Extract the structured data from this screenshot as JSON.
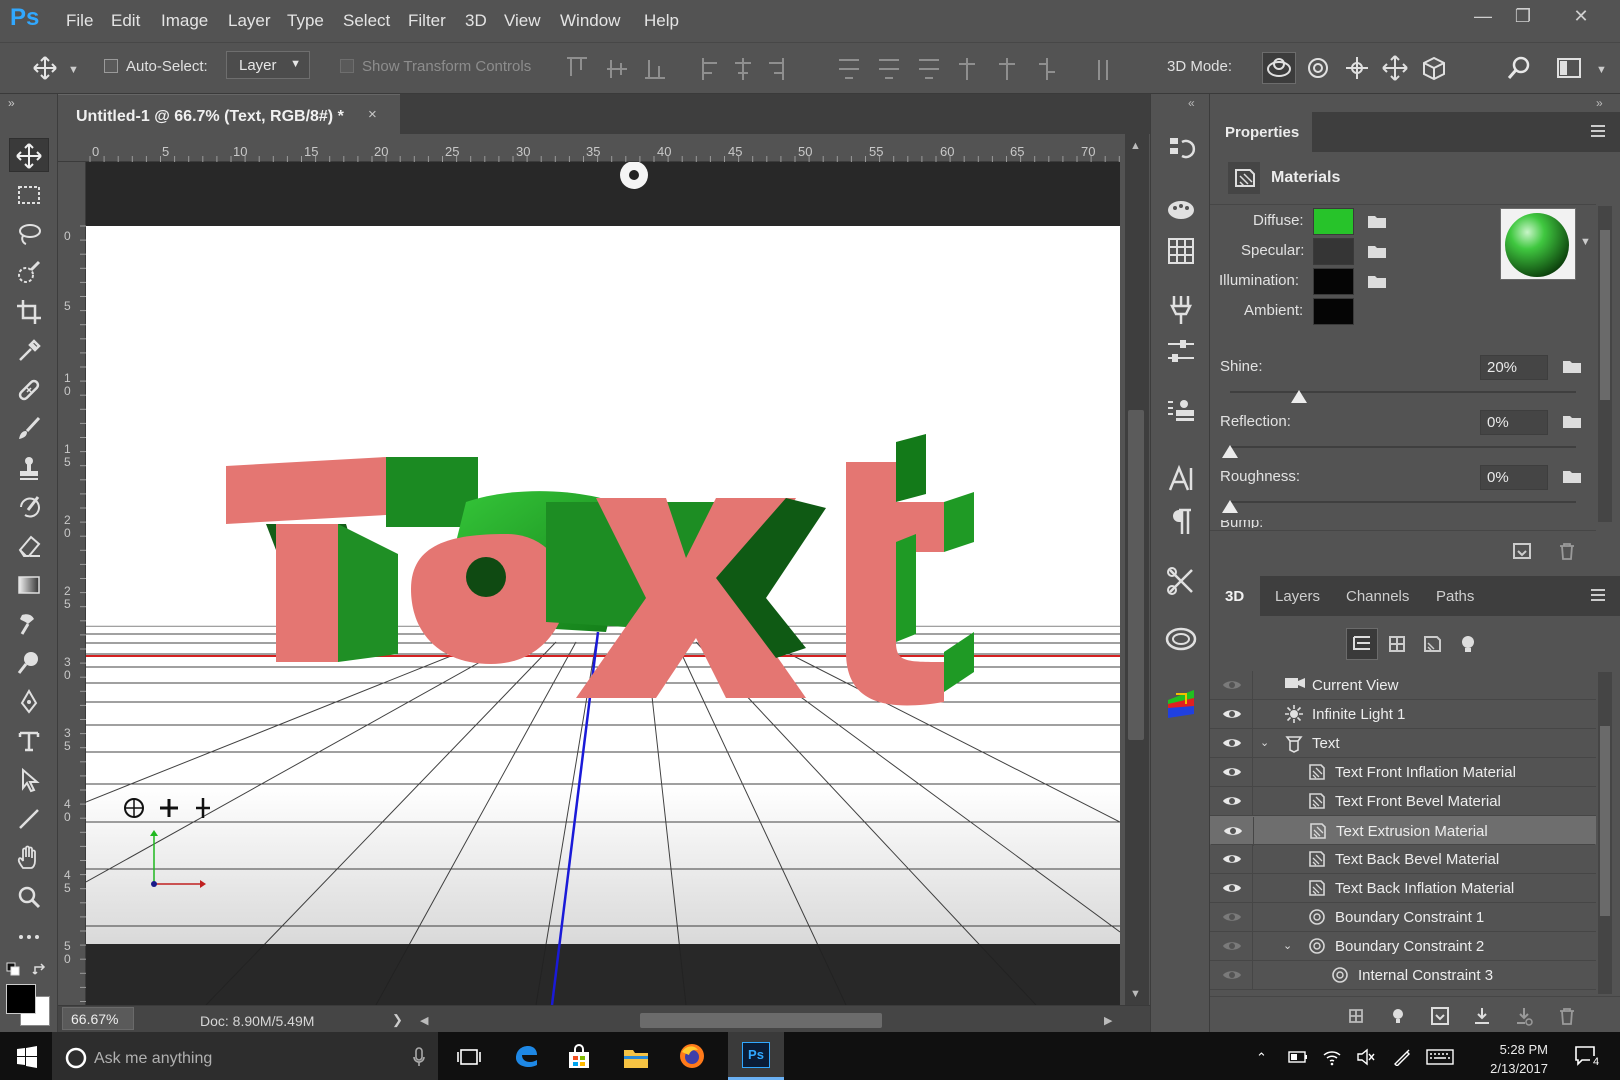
{
  "app": {
    "logo": "Ps"
  },
  "menu": [
    "File",
    "Edit",
    "Image",
    "Layer",
    "Type",
    "Select",
    "Filter",
    "3D",
    "View",
    "Window",
    "Help"
  ],
  "options_bar": {
    "auto_select_label": "Auto-Select:",
    "auto_select_value": "Layer",
    "show_transform_label": "Show Transform Controls",
    "mode_label": "3D Mode:"
  },
  "document": {
    "tab_title": "Untitled-1 @ 66.7% (Text, RGB/8#) *",
    "close_glyph": "×",
    "zoom": "66.67%",
    "doc_info": "Doc: 8.90M/5.49M",
    "canvas_text": "Text"
  },
  "rulers": {
    "horizontal": [
      "0",
      "5",
      "10",
      "15",
      "20",
      "25",
      "30",
      "35",
      "40",
      "45",
      "50",
      "55",
      "60",
      "65",
      "70"
    ],
    "vertical": [
      "0",
      "5",
      "1\n0",
      "1\n5",
      "2\n0",
      "2\n5",
      "3\n0",
      "3\n5",
      "4\n0",
      "4\n5",
      "5\n0"
    ]
  },
  "properties": {
    "tab": "Properties",
    "section": "Materials",
    "diffuse_label": "Diffuse:",
    "specular_label": "Specular:",
    "illumination_label": "Illumination:",
    "ambient_label": "Ambient:",
    "colors": {
      "diffuse": "#27c32a",
      "specular": "#353535",
      "illumination": "#050505",
      "ambient": "#050505"
    },
    "shine": {
      "label": "Shine:",
      "value": "20%",
      "level": 0.2
    },
    "reflection": {
      "label": "Reflection:",
      "value": "0%",
      "level": 0
    },
    "roughness": {
      "label": "Roughness:",
      "value": "0%",
      "level": 0
    },
    "bump_label_partial": "Bump:"
  },
  "layers_panel": {
    "tabs": [
      "3D",
      "Layers",
      "Channels",
      "Paths"
    ],
    "active_tab": "3D",
    "rows": [
      {
        "name": "Current View",
        "icon": "camera-icon",
        "indent": 0,
        "eye": "dim"
      },
      {
        "name": "Infinite Light 1",
        "icon": "light-icon",
        "indent": 0,
        "eye": "on"
      },
      {
        "name": "Text",
        "icon": "mesh-icon",
        "indent": 0,
        "eye": "on",
        "expanded": true
      },
      {
        "name": "Text Front Inflation Material",
        "icon": "material-icon",
        "indent": 1,
        "eye": "on"
      },
      {
        "name": "Text Front Bevel Material",
        "icon": "material-icon",
        "indent": 1,
        "eye": "on"
      },
      {
        "name": "Text Extrusion Material",
        "icon": "material-icon",
        "indent": 1,
        "eye": "on",
        "selected": true
      },
      {
        "name": "Text Back Bevel Material",
        "icon": "material-icon",
        "indent": 1,
        "eye": "on"
      },
      {
        "name": "Text Back Inflation Material",
        "icon": "material-icon",
        "indent": 1,
        "eye": "on"
      },
      {
        "name": "Boundary Constraint 1",
        "icon": "constraint-icon",
        "indent": 1,
        "eye": "dim"
      },
      {
        "name": "Boundary Constraint 2",
        "icon": "constraint-icon",
        "indent": 1,
        "eye": "dim",
        "expanded": true
      },
      {
        "name": "Internal Constraint 3",
        "icon": "constraint-icon",
        "indent": 2,
        "eye": "dim"
      }
    ]
  },
  "taskbar": {
    "search_placeholder": "Ask me anything",
    "time": "5:28 PM",
    "date": "2/13/2017",
    "notifications": "4"
  }
}
